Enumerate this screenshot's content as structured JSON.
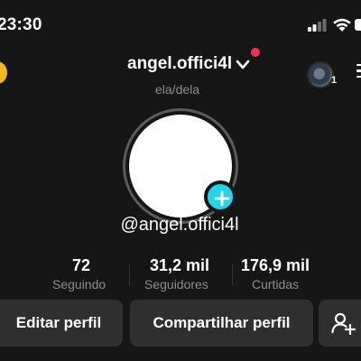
{
  "status_bar": {
    "time": "23:30",
    "icons": [
      "signal-icon",
      "wifi-icon",
      "battery-icon"
    ]
  },
  "header": {
    "username": "angel.offici4l",
    "pronouns": "ela/dela",
    "notification_dot_color": "#fe2c55",
    "avatar_count": "1",
    "icons": [
      "coin-icon",
      "chevron-down-icon",
      "avatar-switcher-icon",
      "menu-icon"
    ]
  },
  "profile": {
    "handle": "@angel.offici4l",
    "add_button_color": "#20d5ec"
  },
  "stats": [
    {
      "value": "72",
      "label": "Seguindo"
    },
    {
      "value": "31,2 mil",
      "label": "Seguidores"
    },
    {
      "value": "176,9 mil",
      "label": "Curtidas"
    }
  ],
  "buttons": {
    "edit": "Editar perfil",
    "share": "Compartilhar perfil",
    "add_friend_icon": "add-user-icon"
  }
}
